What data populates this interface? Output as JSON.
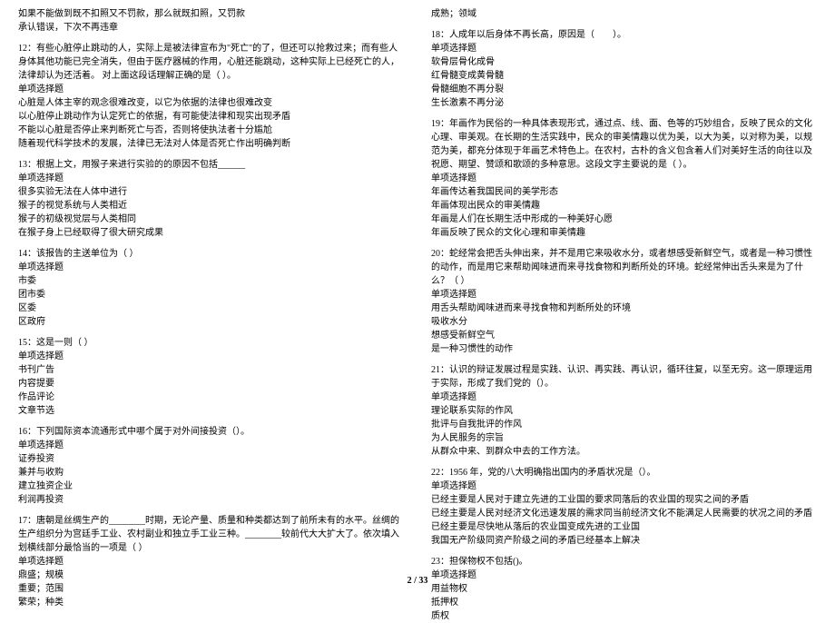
{
  "left": {
    "q11_tail": [
      "如果不能做到既不扣照又不罚款，那么就既扣照，又罚款",
      "承认错误，下次不再违章"
    ],
    "q12": {
      "stem": "12：有些心脏停止跳动的人，实际上是被法律宣布为\"死亡\"的了，但还可以抢救过来；而有些人身体其他功能已完全消失，但由于医疗器械的作用，心脏还能跳动，这种实际上已经死亡的人，法律却认为还活着。 对上面这段话理解正确的是（  ）。",
      "type": "单项选择题",
      "opts": [
        "心脏是人体主宰的观念很难改变，以它为依据的法律也很难改变",
        "以心脏停止跳动作为认定死亡的依据，有可能使法律和现实出现矛盾",
        "不能以心脏是否停止来判断死亡与否，否则将使执法者十分尴尬",
        "随着现代科学技术的发展，法律已无法对人体是否死亡作出明确判断"
      ]
    },
    "q13": {
      "stem": "13：根据上文，用猴子来进行实验的的原因不包括______",
      "type": "单项选择题",
      "opts": [
        "很多实验无法在人体中进行",
        "猴子的视觉系统与人类相近",
        "猴子的初级视觉层与人类相同",
        "在猴子身上已经取得了很大研究成果"
      ]
    },
    "q14": {
      "stem": "14：该报告的主送单位为（  ）",
      "type": "单项选择题",
      "opts": [
        "市委",
        "团市委",
        "区委",
        "区政府"
      ]
    },
    "q15": {
      "stem": "15：这是一则（  ）",
      "type": "单项选择题",
      "opts": [
        "书刊广告",
        "内容提要",
        "作品评论",
        "文章节选"
      ]
    },
    "q16": {
      "stem": "16：下列国际资本流通形式中哪个属于对外间接投资（）。",
      "type": "单项选择题",
      "opts": [
        "证券投资",
        "兼并与收购",
        "建立独资企业",
        "利润再投资"
      ]
    },
    "q17": {
      "stem": "17：唐朝是丝绸生产的________时期，无论产量、质量和种类都达到了前所未有的水平。丝绸的生产组织分为宫廷手工业、农村副业和独立手工业三种。________较前代大大扩大了。依次填入划横线部分最恰当的一项是（  ）",
      "type": "单项选择题",
      "opts": [
        "鼎盛；规模",
        "重要；范围",
        "繁荣；种类"
      ]
    }
  },
  "right": {
    "q17_tail": [
      "成熟；领域"
    ],
    "q18": {
      "stem": "18：人成年以后身体不再长高，原因是（　　）。",
      "type": "单项选择题",
      "opts": [
        "软骨层骨化成骨",
        "红骨髓变成黄骨髓",
        "骨髓细胞不再分裂",
        "生长激素不再分泌"
      ]
    },
    "q19": {
      "stem": "19：年画作为民俗的一种具体表现形式，通过点、线、面、色等的巧妙组合，反映了民众的文化心理、审美观。在长期的生活实践中，民众的审美情趣以优为美，以大为美，以对称为美，以规范为美，都充分体现于年画艺术特色上。在农村，古朴的含义包含着人们对美好生活的向往以及祝愿、期望、赞颂和歌颂的多种意思。这段文字主要说的是（  ）。",
      "type": "单项选择题",
      "opts": [
        "年画传达着我国民间的美学形态",
        "年画体现出民众的审美情趣",
        "年画是人们在长期生活中形成的一种美好心愿",
        "年画反映了民众的文化心理和审美情趣"
      ]
    },
    "q20": {
      "stem": "20：蛇经常会把舌头伸出来，并不是用它来吸收水分，或者想感受新鲜空气，或者是一种习惯性的动作，而是用它来帮助闻味进而来寻找食物和判断所处的环境。蛇经常伸出舌头来是为了什么？（  ）",
      "type": "单项选择题",
      "opts": [
        "用舌头帮助闻味进而来寻找食物和判断所处的环境",
        "吸收水分",
        "想感受新鲜空气",
        "是一种习惯性的动作"
      ]
    },
    "q21": {
      "stem": "21：认识的辩证发展过程是实践、认识、再实践、再认识，循环往复，以至无穷。这一原理运用于实际，形成了我们党的（）。",
      "type": "单项选择题",
      "opts": [
        "理论联系实际的作风",
        "批评与自我批评的作风",
        "为人民服务的宗旨",
        "从群众中来、到群众中去的工作方法。"
      ]
    },
    "q22": {
      "stem": "22：1956 年，党的八大明确指出国内的矛盾状况是（）。",
      "type": "单项选择题",
      "opts": [
        "已经主要是人民对于建立先进的工业国的要求同落后的农业国的现实之间的矛盾",
        "已经主要是人民对经济文化迅速发展的需求同当前经济文化不能满足人民需要的状况之间的矛盾",
        "已经主要是尽快地从落后的农业国变成先进的工业国",
        "我国无产阶级同资产阶级之间的矛盾已经基本上解决"
      ]
    },
    "q23": {
      "stem": "23：担保物权不包括()。",
      "type": "单项选择题",
      "opts": [
        "用益物权",
        "抵押权",
        "质权"
      ]
    }
  },
  "pagenum": "2 / 33"
}
